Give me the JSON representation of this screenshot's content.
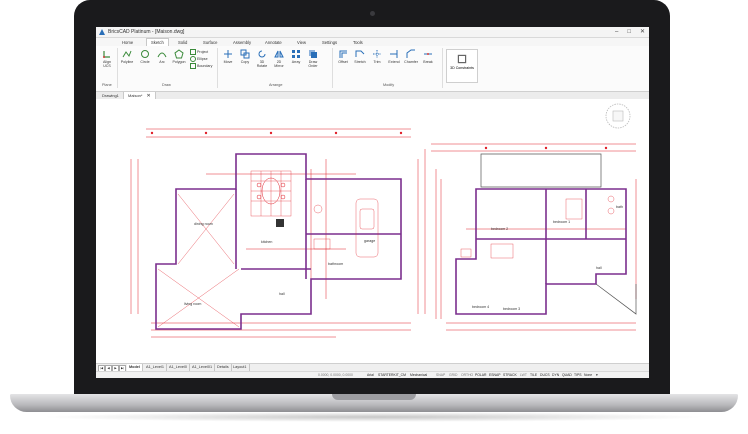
{
  "window": {
    "title": "BricsCAD Platinum - [Maison.dwg]",
    "minimize": "–",
    "maximize": "□",
    "close": "✕"
  },
  "ribbon_tabs": [
    "Home",
    "Sketch",
    "Solid",
    "Surface",
    "Assembly",
    "Annotate",
    "View",
    "Settings",
    "Tools"
  ],
  "active_ribbon_tab": "Sketch",
  "tools": [
    {
      "label": "Align\nUCS"
    },
    {
      "label": "Polyline"
    },
    {
      "label": "Circle"
    },
    {
      "label": "Arc"
    },
    {
      "label": "Polygon"
    },
    {
      "label": "Move"
    },
    {
      "label": "Copy"
    },
    {
      "label": "3D\nRotate"
    },
    {
      "label": "2D\nMirror"
    },
    {
      "label": "Array"
    },
    {
      "label": "Draw\nOrder"
    },
    {
      "label": "Offset"
    },
    {
      "label": "Stretch"
    },
    {
      "label": "Trim"
    },
    {
      "label": "Extend"
    },
    {
      "label": "Chamfer"
    },
    {
      "label": "Break"
    }
  ],
  "small_tools": [
    "Project",
    "Ellipse",
    "Boundary"
  ],
  "group_labels": {
    "plane": "Plane",
    "draw": "Draw",
    "arrange": "Arrange",
    "modify": "Modify"
  },
  "constraints_label": "3D Constraints",
  "doc_tabs": [
    {
      "label": "Drawing1"
    },
    {
      "label": "Maison*"
    }
  ],
  "layout_tabs": [
    "Model",
    "A1_Level1",
    "A1_Level0",
    "A1_Level01",
    "Details",
    "Layout1"
  ],
  "status": {
    "coords": "0.0000, 0.0000, 0.0000",
    "font": "Arial",
    "style": "STARTERKIT_CM",
    "profile": "Mechanical",
    "toggles": [
      "SNAP",
      "GRID",
      "ORTHO",
      "POLAR",
      "ESNAP",
      "STRACK",
      "LWT",
      "TILE",
      "DUCS",
      "DYN",
      "QUAD",
      "TIPS"
    ],
    "on_toggles": [
      "POLAR",
      "ESNAP",
      "STRACK",
      "TILE",
      "DUCS",
      "DYN",
      "QUAD",
      "TIPS"
    ],
    "none": "None"
  },
  "plan_labels": {
    "dining": "dining room",
    "living": "living room",
    "kitchen": "kitchen",
    "garage": "garage",
    "bathroom": "bathroom",
    "hall": "hall",
    "bedroom1": "bedroom 1",
    "bedroom2": "bedroom 2",
    "bedroom3": "bedroom 3",
    "bedroom4": "bedroom 4",
    "bath2": "bath",
    "hall2": "hall"
  },
  "colors": {
    "dim_red": "#e0202a",
    "wall_purple": "#7b2f8e",
    "grid_gray": "#b0b0b0"
  }
}
